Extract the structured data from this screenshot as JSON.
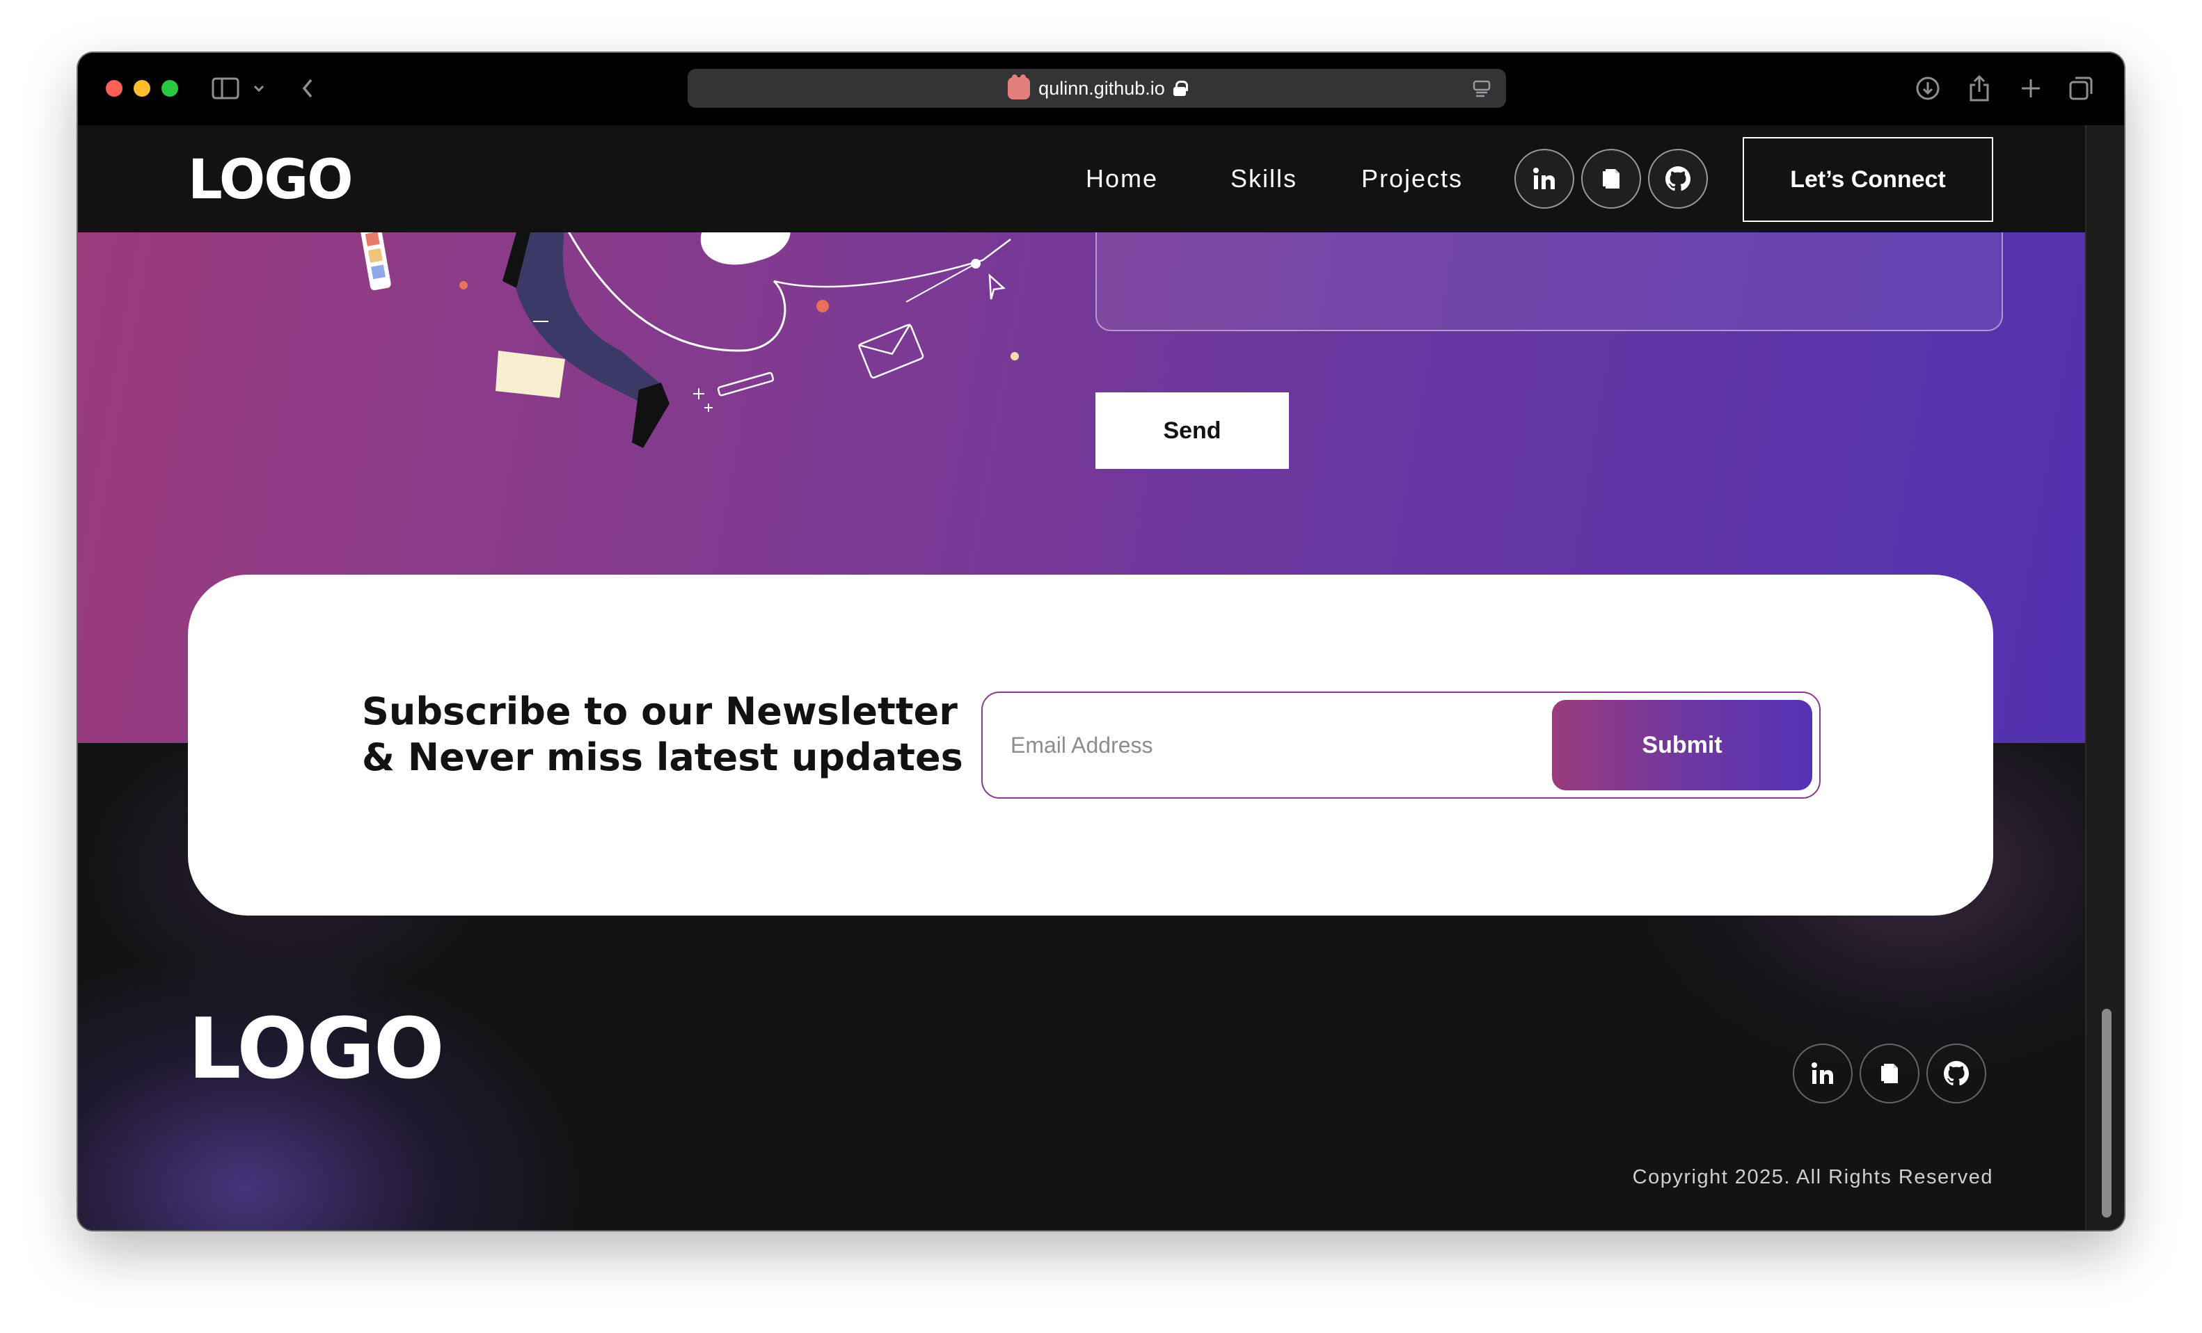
{
  "browser": {
    "url": "qulinn.github.io",
    "icons": [
      "sidebar-icon",
      "chevron-down-icon",
      "back-icon",
      "reader-icon",
      "download-icon",
      "share-icon",
      "plus-icon",
      "tabs-icon"
    ]
  },
  "nav": {
    "logo": "LOGO",
    "links": [
      "Home",
      "Skills",
      "Projects"
    ],
    "social": [
      "linkedin-icon",
      "resume-icon",
      "github-icon"
    ],
    "cta": "Let’s Connect"
  },
  "contact": {
    "message_value": "",
    "send_label": "Send"
  },
  "newsletter": {
    "title_line1": "Subscribe to our Newsletter",
    "title_line2": "& Never miss latest updates",
    "email_placeholder": "Email Address",
    "submit_label": "Submit"
  },
  "footer": {
    "logo": "LOGO",
    "social": [
      "linkedin-icon",
      "resume-icon",
      "github-icon"
    ],
    "copyright": "Copyright 2025. All Rights Reserved"
  },
  "colors": {
    "gradient_start": "#9a3b7d",
    "gradient_end": "#5232b0",
    "navbar": "#121212",
    "footer": "#141314"
  }
}
